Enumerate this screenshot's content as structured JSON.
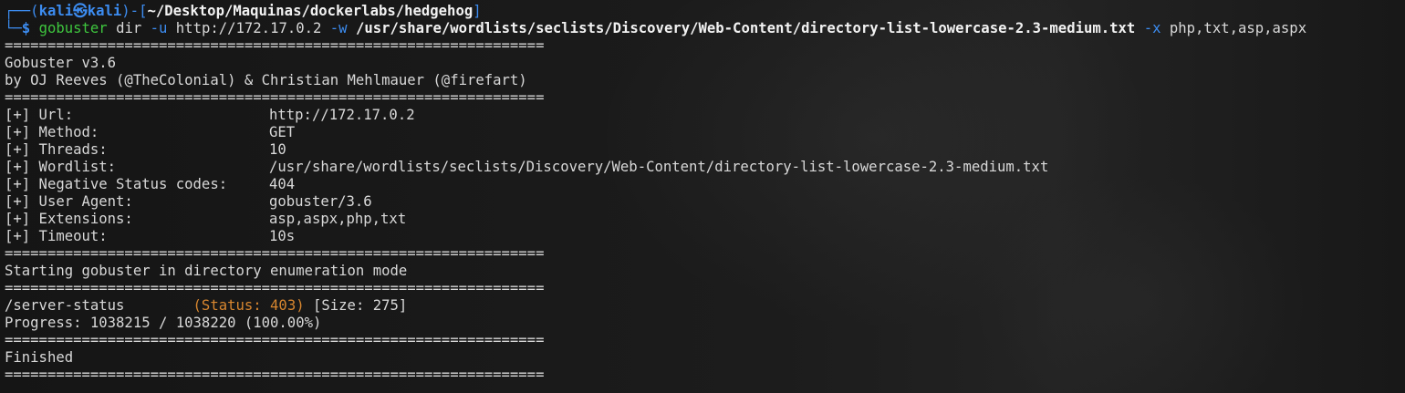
{
  "prompt": {
    "user": "kali",
    "host": "kali",
    "at_symbol": "㉿",
    "path": "~/Desktop/Maquinas/dockerlabs/hedgehog",
    "prompt_char": "$"
  },
  "command": {
    "program": "gobuster",
    "subcommand": "dir",
    "flag_u": "-u",
    "url": "http://172.17.0.2",
    "flag_w": "-w",
    "wordlist": "/usr/share/wordlists/seclists/Discovery/Web-Content/directory-list-lowercase-2.3-medium.txt",
    "flag_x": "-x",
    "extensions": "php,txt,asp,aspx"
  },
  "separator": "===============================================================",
  "banner": {
    "version": "Gobuster v3.6",
    "authors": "by OJ Reeves (@TheColonial) & Christian Mehlmauer (@firefart)"
  },
  "config": [
    {
      "key": "[+] Url:",
      "value": "http://172.17.0.2"
    },
    {
      "key": "[+] Method:",
      "value": "GET"
    },
    {
      "key": "[+] Threads:",
      "value": "10"
    },
    {
      "key": "[+] Wordlist:",
      "value": "/usr/share/wordlists/seclists/Discovery/Web-Content/directory-list-lowercase-2.3-medium.txt"
    },
    {
      "key": "[+] Negative Status codes:",
      "value": "404"
    },
    {
      "key": "[+] User Agent:",
      "value": "gobuster/3.6"
    },
    {
      "key": "[+] Extensions:",
      "value": "asp,aspx,php,txt"
    },
    {
      "key": "[+] Timeout:",
      "value": "10s"
    }
  ],
  "starting": "Starting gobuster in directory enumeration mode",
  "result": {
    "path": "/server-status",
    "status": "(Status: 403)",
    "size": "[Size: 275]"
  },
  "progress": "Progress: 1038215 / 1038220 (100.00%)",
  "finished": "Finished",
  "colors": {
    "prompt_blue": "#3c8cf0",
    "command_green": "#3ec53e",
    "status_orange": "#d7862f",
    "text": "#d8d8d8"
  }
}
